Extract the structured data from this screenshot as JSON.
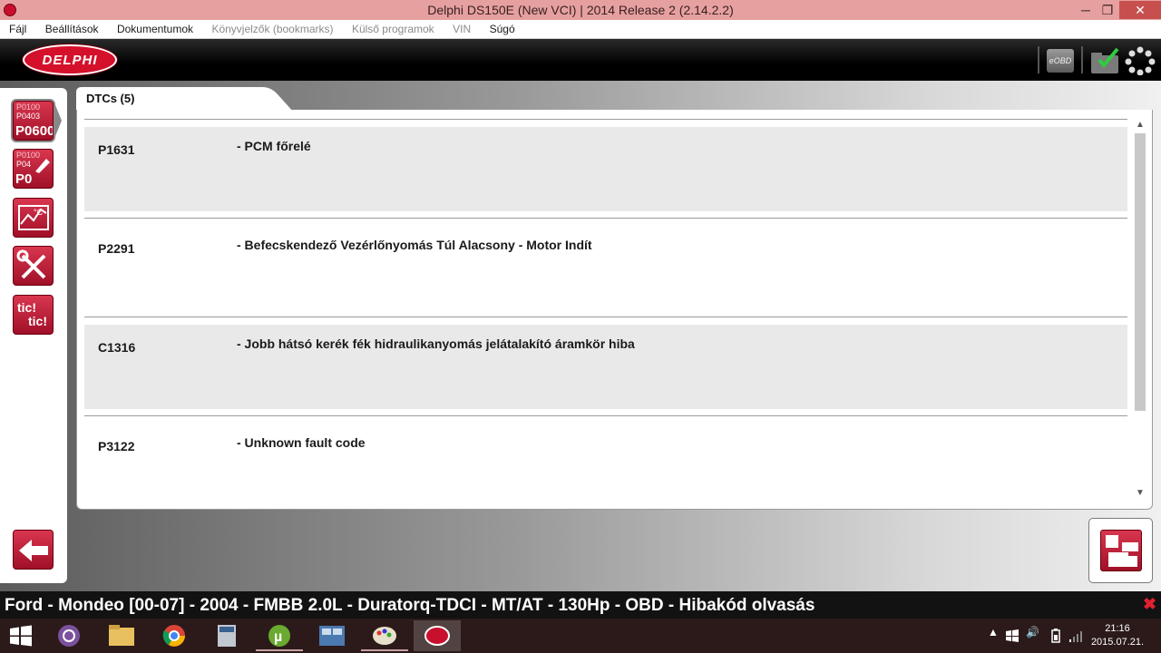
{
  "window": {
    "title": "Delphi DS150E (New VCI) | 2014 Release 2 (2.14.2.2)",
    "minimize_icon": "minimize-icon",
    "maximize_icon": "restore-icon",
    "close_icon": "close-icon"
  },
  "menu": {
    "items": [
      {
        "label": "Fájl",
        "enabled": true
      },
      {
        "label": "Beállítások",
        "enabled": true
      },
      {
        "label": "Dokumentumok",
        "enabled": true
      },
      {
        "label": "Könyvjelzők (bookmarks)",
        "enabled": false
      },
      {
        "label": "Külső programok",
        "enabled": false
      },
      {
        "label": "VIN",
        "enabled": false
      },
      {
        "label": "Súgó",
        "enabled": true
      }
    ]
  },
  "header": {
    "logo_text": "DELPHI",
    "eobd_label": "eOBD",
    "folder_icon": "folder-check-icon",
    "settings_icon": "loading-gear-icon"
  },
  "sidebar": {
    "read_dtc": {
      "small1": "P0100",
      "small2": "P0403",
      "big": "P0600"
    },
    "clear_dtc": {
      "small1": "P0100",
      "small2": "P04",
      "big": "P0"
    },
    "tic_label_1": "tic!",
    "tic_label_2": "tic!",
    "accent": "#c8102e"
  },
  "dtc_tab": {
    "label": "DTCs (5)"
  },
  "dtcs": [
    {
      "code": "P1631",
      "description": "- PCM főrelé"
    },
    {
      "code": "P2291",
      "description": "- Befecskendező Vezérlőnyomás Túl Alacsony - Motor Indít"
    },
    {
      "code": "C1316",
      "description": "- Jobb hátsó kerék fék hidraulikanyomás jelátalakító áramkör hiba"
    },
    {
      "code": "P3122",
      "description": "- Unknown fault code"
    }
  ],
  "status": {
    "text": "Ford - Mondeo [00-07] - 2004 - FMBB 2.0L - Duratorq-TDCI - MT/AT - 130Hp - OBD - Hibakód olvasás",
    "close_symbol": "✖"
  },
  "taskbar": {
    "clock_time": "21:16",
    "clock_date": "2015.07.21."
  }
}
